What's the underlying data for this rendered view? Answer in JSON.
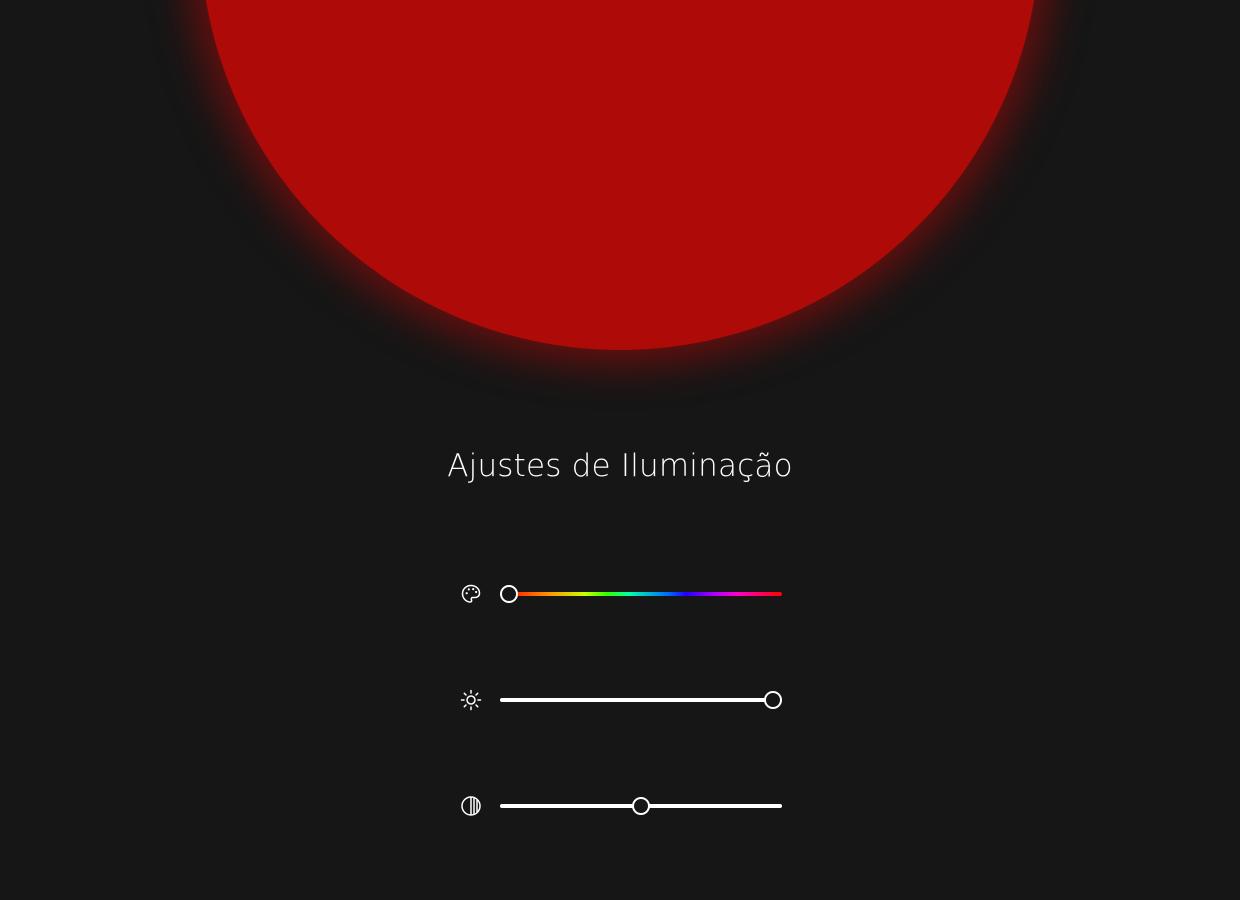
{
  "light": {
    "color": "#ad0a08"
  },
  "panel": {
    "title": "Ajustes de Iluminação"
  },
  "controls": {
    "hue": {
      "icon": "palette-icon",
      "value_fraction": 0.0
    },
    "brightness": {
      "icon": "sun-icon",
      "value_fraction": 1.0
    },
    "contrast": {
      "icon": "contrast-icon",
      "value_fraction": 0.5
    }
  },
  "colors": {
    "background": "#161616",
    "foreground": "#ffffff"
  }
}
